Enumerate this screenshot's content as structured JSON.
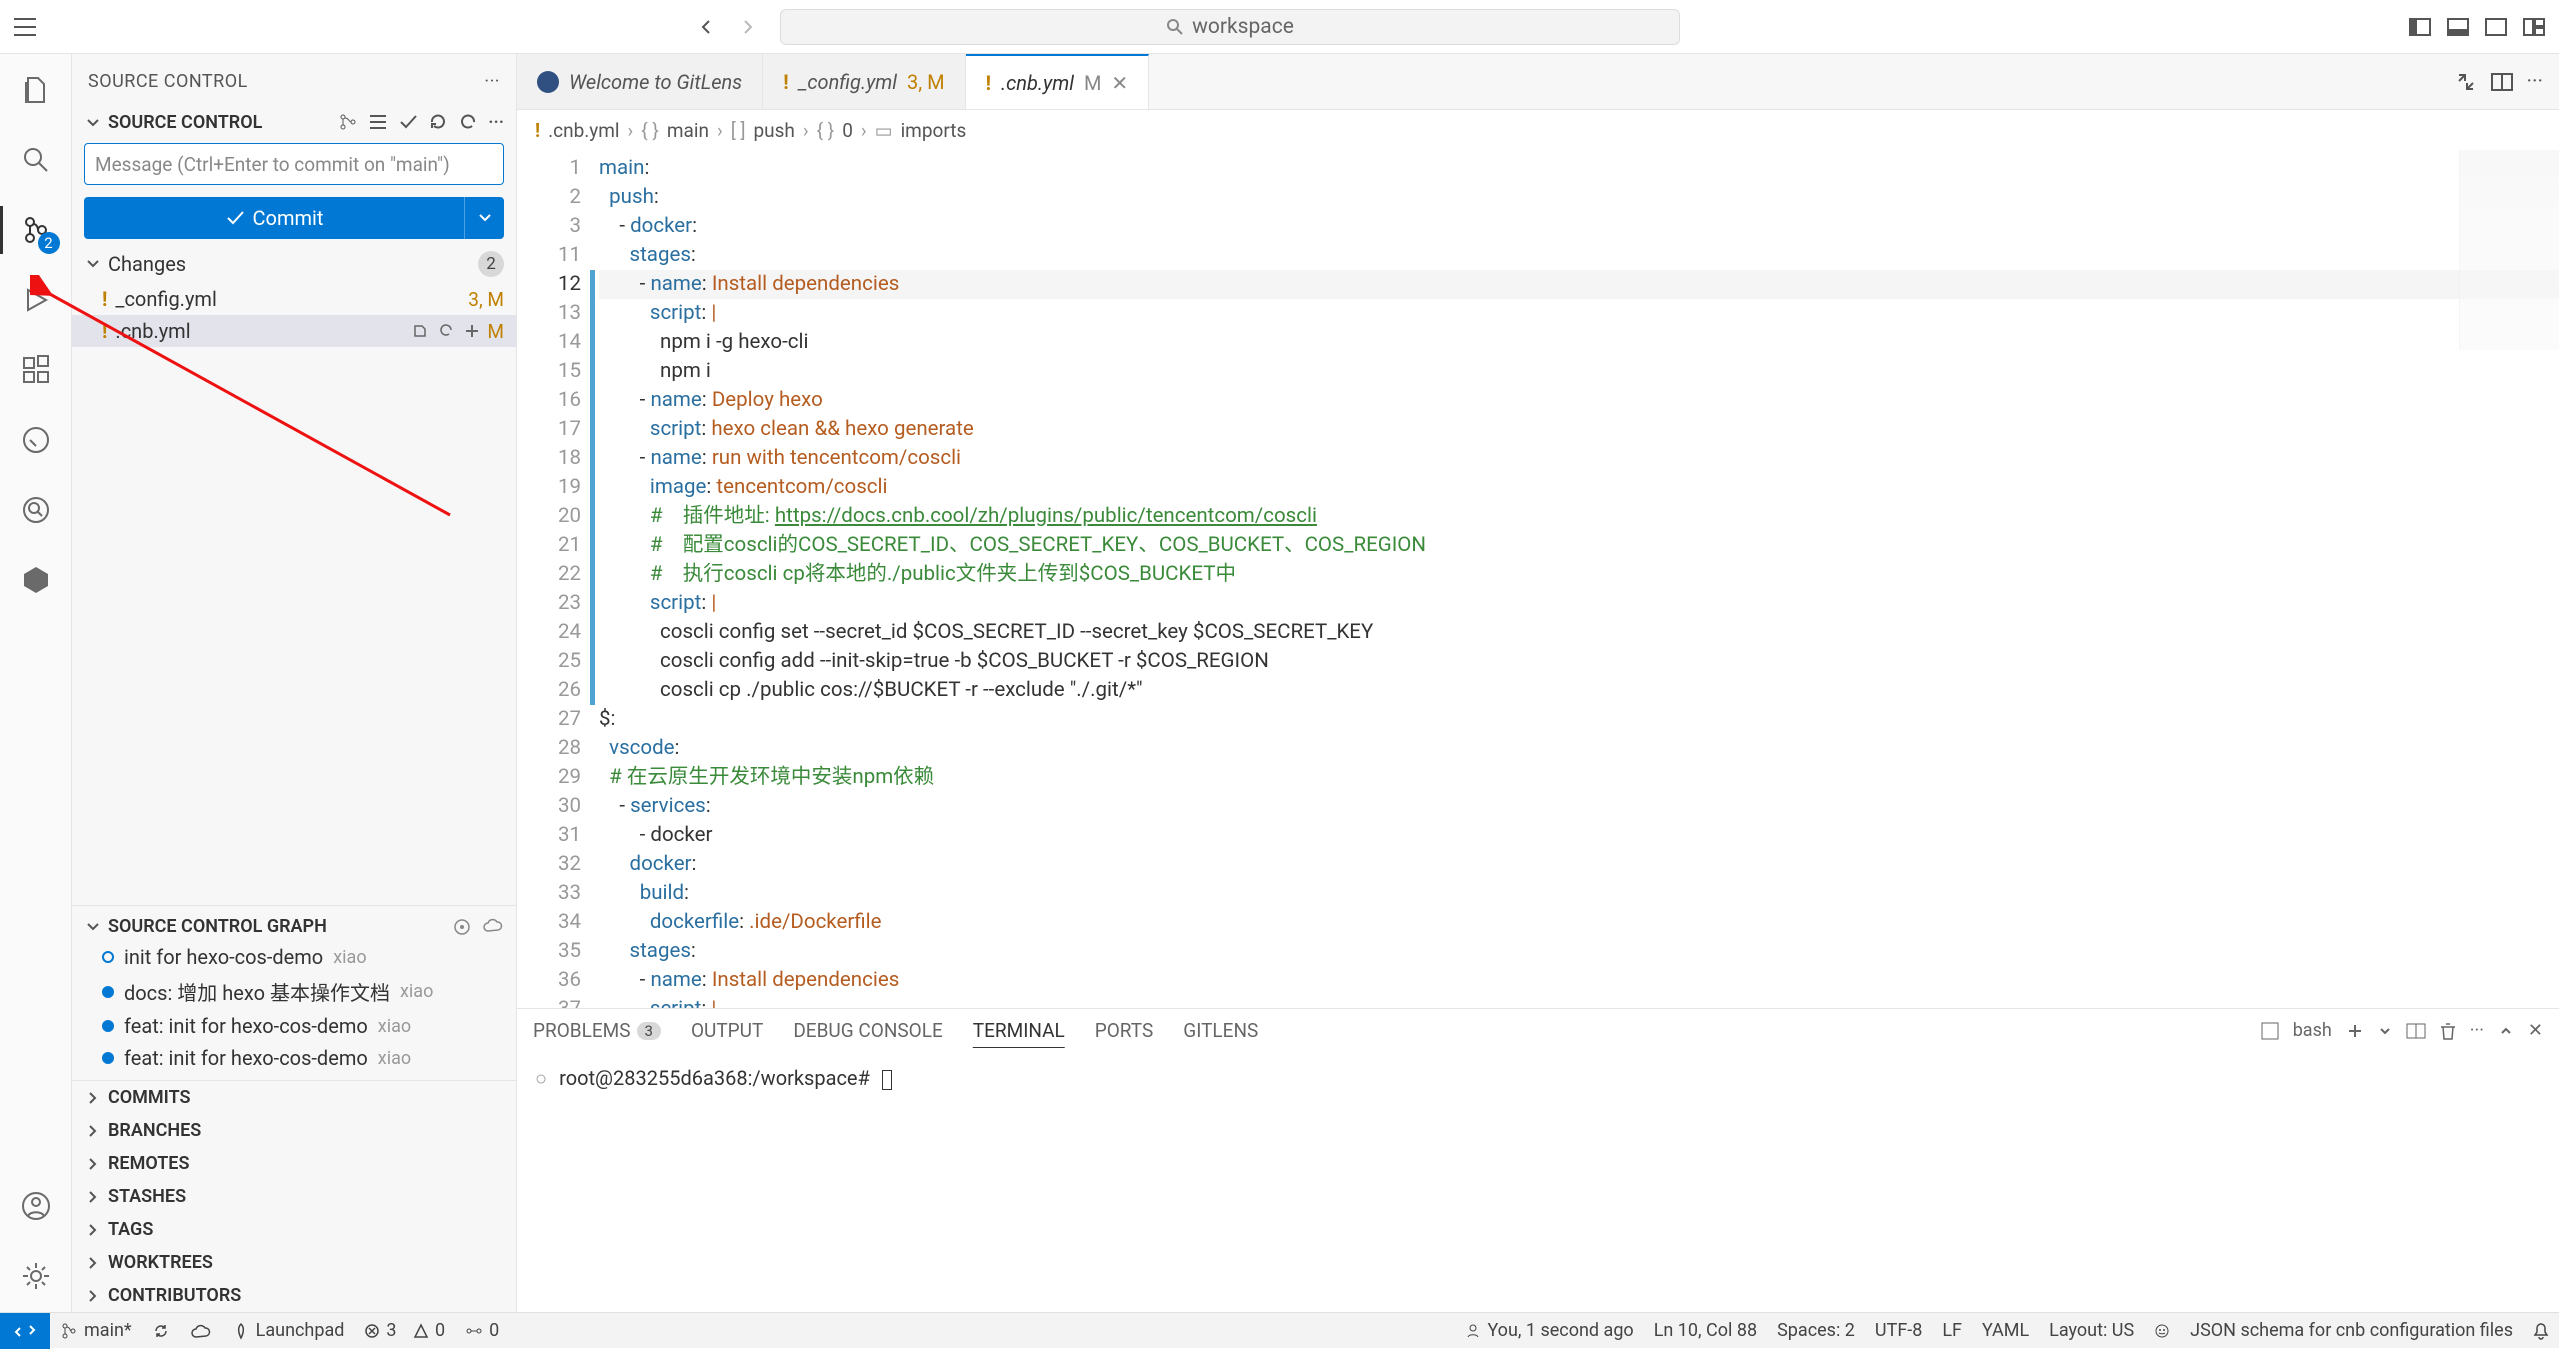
{
  "titlebar": {
    "search_placeholder": "workspace"
  },
  "activitybar": {
    "scm_badge": "2"
  },
  "sidebar": {
    "title": "SOURCE CONTROL",
    "section_title": "SOURCE CONTROL",
    "commit_placeholder": "Message (Ctrl+Enter to commit on \"main\")",
    "commit_button": "Commit",
    "changes_label": "Changes",
    "changes_count": "2",
    "files": [
      {
        "name": "_config.yml",
        "status": "3, M"
      },
      {
        "name": ".cnb.yml",
        "status": "M"
      }
    ],
    "graph_title": "SOURCE CONTROL GRAPH",
    "graph": [
      {
        "msg": "init for hexo-cos-demo",
        "author": "xiao"
      },
      {
        "msg": "docs: 增加 hexo 基本操作文档",
        "author": "xiao"
      },
      {
        "msg": "feat: init for hexo-cos-demo",
        "author": "xiao"
      },
      {
        "msg": "feat: init for hexo-cos-demo",
        "author": "xiao"
      }
    ],
    "sections": [
      "COMMITS",
      "BRANCHES",
      "REMOTES",
      "STASHES",
      "TAGS",
      "WORKTREES",
      "CONTRIBUTORS"
    ]
  },
  "tabs": {
    "gitlens": "Welcome to GitLens",
    "config": {
      "name": "_config.yml",
      "status": "3, M"
    },
    "cnb": {
      "name": ".cnb.yml",
      "status": "M"
    }
  },
  "breadcrumb": {
    "file": ".cnb.yml",
    "p1": "main",
    "p2": "push",
    "p3": "0",
    "p4": "imports"
  },
  "code": {
    "start": 1,
    "current": 12,
    "lines": [
      "main:",
      "  push:",
      "    - docker:",
      "      stages:",
      "        - name: Install dependencies",
      "          script: |",
      "            npm i -g hexo-cli",
      "            npm i",
      "        - name: Deploy hexo",
      "          script: hexo clean && hexo generate",
      "        - name: run with tencentcom/coscli",
      "          image: tencentcom/coscli",
      "          #    插件地址: https://docs.cnb.cool/zh/plugins/public/tencentcom/coscli",
      "          #    配置coscli的COS_SECRET_ID、COS_SECRET_KEY、COS_BUCKET、COS_REGION",
      "          #    执行coscli cp将本地的./public文件夹上传到$COS_BUCKET中",
      "          script: |",
      "            coscli config set --secret_id $COS_SECRET_ID --secret_key $COS_SECRET_KEY",
      "            coscli config add --init-skip=true -b $COS_BUCKET -r $COS_REGION",
      "            coscli cp ./public cos://$BUCKET -r --exclude \"./.git/*\"",
      "$:",
      "  vscode:",
      "  # 在云原生开发环境中安装npm依赖",
      "    - services:",
      "        - docker",
      "      docker:",
      "        build:",
      "          dockerfile: .ide/Dockerfile",
      "      stages:",
      "        - name: Install dependencies",
      "          script: |"
    ]
  },
  "panel": {
    "tabs": [
      "PROBLEMS",
      "OUTPUT",
      "DEBUG CONSOLE",
      "TERMINAL",
      "PORTS",
      "GITLENS"
    ],
    "problems_badge": "3",
    "term_label": "bash"
  },
  "terminal": {
    "prompt": "root@283255d6a368:/workspace#"
  },
  "statusbar": {
    "branch": "main*",
    "launchpad": "Launchpad",
    "errors": "3",
    "warnings": "0",
    "ports": "0",
    "blame": "You, 1 second ago",
    "pos": "Ln 10, Col 88",
    "spaces": "Spaces: 2",
    "enc": "UTF-8",
    "eol": "LF",
    "lang": "YAML",
    "layout": "Layout: US",
    "schema": "JSON schema for cnb configuration files"
  }
}
